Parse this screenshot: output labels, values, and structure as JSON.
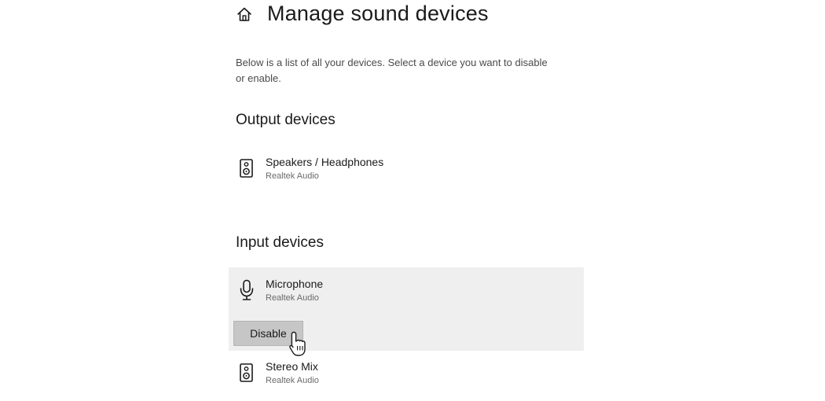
{
  "header": {
    "icon": "home-icon",
    "title": "Manage sound devices"
  },
  "description": "Below is a list of all your devices. Select a device you want to disable or enable.",
  "output_section": {
    "heading": "Output devices",
    "devices": [
      {
        "name": "Speakers / Headphones",
        "driver": "Realtek Audio",
        "icon": "speaker-icon"
      }
    ]
  },
  "input_section": {
    "heading": "Input devices",
    "devices": [
      {
        "name": "Microphone",
        "driver": "Realtek Audio",
        "icon": "microphone-icon",
        "selected": true
      },
      {
        "name": "Stereo Mix",
        "driver": "Realtek Audio",
        "icon": "speaker-icon"
      }
    ],
    "action_label": "Disable"
  },
  "colors": {
    "selected_background": "#efefef",
    "button_background": "#c6c6c6",
    "text_primary": "#1a1a1a",
    "text_secondary": "#6a6a6a"
  }
}
